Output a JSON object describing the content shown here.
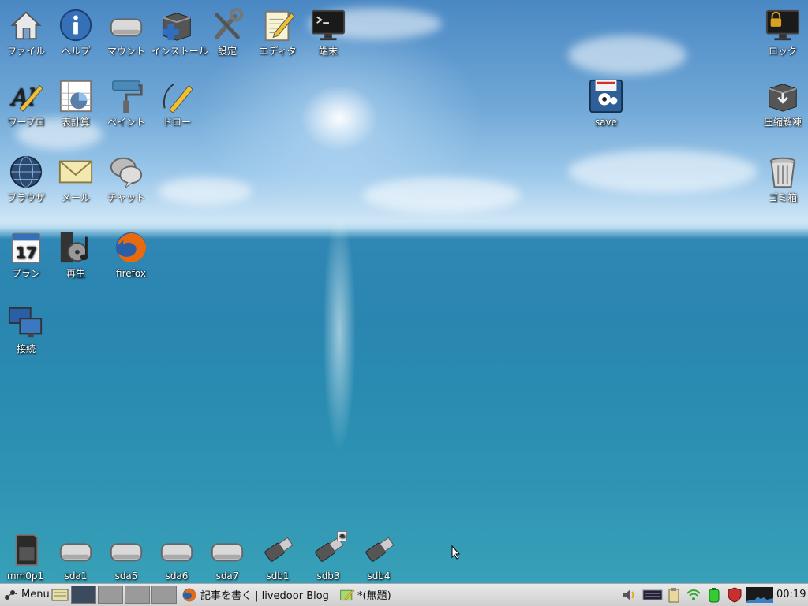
{
  "desktop": {
    "icons_top": [
      {
        "label": "ファイル",
        "icon": "home-icon"
      },
      {
        "label": "ヘルプ",
        "icon": "info-icon"
      },
      {
        "label": "マウント",
        "icon": "drive-icon"
      },
      {
        "label": "インストール",
        "icon": "install-icon"
      },
      {
        "label": "設定",
        "icon": "settings-tools-icon"
      },
      {
        "label": "エディタ",
        "icon": "editor-icon"
      },
      {
        "label": "端末",
        "icon": "terminal-icon"
      }
    ],
    "icons_row2": [
      {
        "label": "ワープロ",
        "icon": "wordprocessor-icon"
      },
      {
        "label": "表計算",
        "icon": "spreadsheet-icon"
      },
      {
        "label": "ペイント",
        "icon": "paint-roller-icon"
      },
      {
        "label": "ドロー",
        "icon": "draw-pen-icon"
      }
    ],
    "icons_row3": [
      {
        "label": "ブラウザ",
        "icon": "globe-icon"
      },
      {
        "label": "メール",
        "icon": "mail-icon"
      },
      {
        "label": "チャット",
        "icon": "chat-icon"
      }
    ],
    "icons_row4": [
      {
        "label": "プラン",
        "icon": "calendar-icon",
        "day": "17"
      },
      {
        "label": "再生",
        "icon": "media-player-icon"
      },
      {
        "label": "firefox",
        "icon": "firefox-icon"
      }
    ],
    "icon_connect": {
      "label": "接続",
      "icon": "network-icon"
    },
    "icon_save": {
      "label": "save",
      "icon": "save-icon"
    },
    "icon_lock": {
      "label": "ロック",
      "icon": "lock-icon"
    },
    "icon_archive": {
      "label": "圧縮解凍",
      "icon": "archive-icon"
    },
    "icon_trash": {
      "label": "ゴミ箱",
      "icon": "trash-icon"
    },
    "drives": [
      {
        "label": "mm0p1",
        "icon": "sdcard-icon"
      },
      {
        "label": "sda1",
        "icon": "drive-icon"
      },
      {
        "label": "sda5",
        "icon": "drive-icon"
      },
      {
        "label": "sda6",
        "icon": "drive-icon"
      },
      {
        "label": "sda7",
        "icon": "drive-icon"
      },
      {
        "label": "sdb1",
        "icon": "usb-icon"
      },
      {
        "label": "sdb3",
        "icon": "usb-icon"
      },
      {
        "label": "sdb4",
        "icon": "usb-icon"
      }
    ]
  },
  "taskbar": {
    "menu_label": "Menu",
    "tasks": [
      {
        "label": "記事を書く | livedoor Blog",
        "icon": "firefox-icon"
      },
      {
        "label": "*(無題)",
        "icon": "editor-icon"
      }
    ],
    "clock": "00:19",
    "colors": {
      "active_workspace": "#3b4a5c",
      "panel": "#dcdcdc"
    }
  }
}
